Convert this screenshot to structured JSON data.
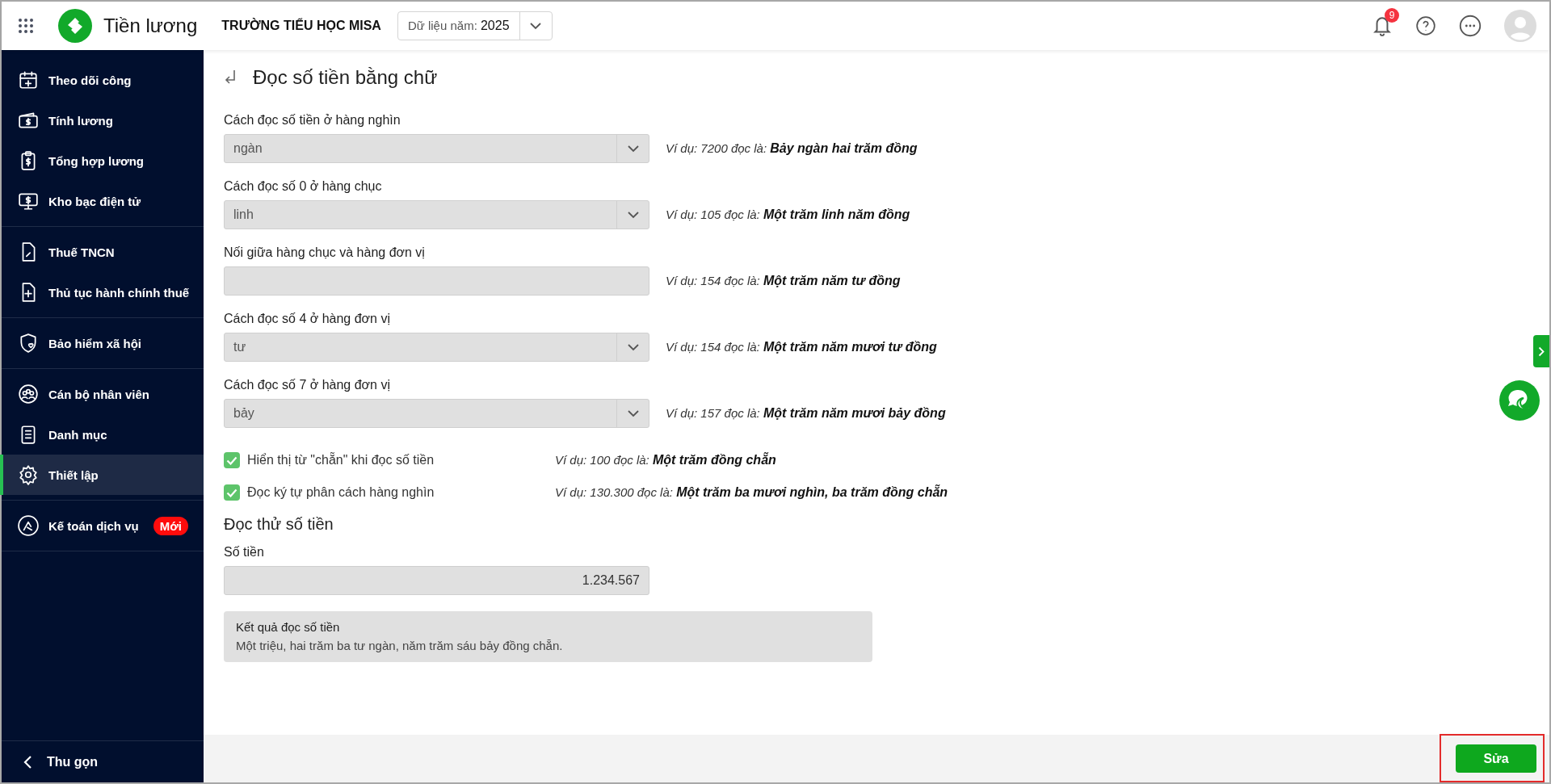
{
  "header": {
    "app_name": "Tiền lương",
    "org_name": "TRƯỜNG TIỂU HỌC MISA",
    "year_selector": {
      "label": "Dữ liệu năm:",
      "value": "2025"
    },
    "notification_count": "9"
  },
  "sidebar": {
    "groups": [
      {
        "items": [
          {
            "label": "Theo dõi công",
            "selected": false
          },
          {
            "label": "Tính lương",
            "selected": false
          },
          {
            "label": "Tổng hợp lương",
            "selected": false
          },
          {
            "label": "Kho bạc điện tử",
            "selected": false
          }
        ]
      },
      {
        "items": [
          {
            "label": "Thuế TNCN",
            "selected": false
          },
          {
            "label": "Thủ tục hành chính thuế",
            "selected": false
          }
        ]
      },
      {
        "items": [
          {
            "label": "Bảo hiểm xã hội",
            "selected": false
          }
        ]
      },
      {
        "items": [
          {
            "label": "Cán bộ nhân viên",
            "selected": false
          },
          {
            "label": "Danh mục",
            "selected": false
          },
          {
            "label": "Thiết lập",
            "selected": true
          }
        ]
      },
      {
        "items": [
          {
            "label": "Kế toán dịch vụ",
            "selected": false,
            "badge": "Mới"
          }
        ]
      }
    ],
    "collapse_label": "Thu gọn"
  },
  "page": {
    "title": "Đọc số tiền bằng chữ",
    "fields": [
      {
        "kind": "select",
        "label": "Cách đọc số tiền ở hàng nghìn",
        "value": "ngàn",
        "example": "Ví dụ: 7200 đọc là: **Bảy ngàn hai trăm đồng**"
      },
      {
        "kind": "select",
        "label": "Cách đọc số 0 ở hàng chục",
        "value": "linh",
        "example": "Ví dụ: 105 đọc là: **Một trăm linh năm đồng**"
      },
      {
        "kind": "text",
        "label": "Nối giữa hàng chục và hàng đơn vị",
        "example": "Ví dụ: 154 đọc là: **Một trăm năm tư đồng**"
      },
      {
        "kind": "select",
        "label": "Cách đọc số 4 ở hàng đơn vị",
        "value": "tư",
        "example": "Ví dụ: 154 đọc là: **Một trăm năm mươi tư đồng**"
      },
      {
        "kind": "select",
        "label": "Cách đọc số 7 ở hàng đơn vị",
        "value": "bảy",
        "example": "Ví dụ: 157 đọc là: **Một trăm năm mươi bảy đồng**"
      }
    ],
    "options": [
      {
        "label": "Hiển thị từ \"chẵn\" khi đọc số tiền",
        "checked": true,
        "example": "Ví dụ: 100 đọc là: **Một trăm đồng chẵn**"
      },
      {
        "label": "Đọc ký tự phân cách hàng nghìn",
        "checked": true,
        "example": "Ví dụ: 130.300 đọc là: **Một trăm ba mươi nghìn, ba trăm đồng chẵn**"
      }
    ],
    "test_section": {
      "title": "Đọc thử số tiền",
      "amount_label": "Số tiền",
      "amount_value": "1.234.567",
      "result_title": "Kết quả đọc số tiền",
      "result_text": "Một triệu, hai trăm ba tư ngàn, năm trăm sáu bảy đồng chẵn."
    }
  },
  "footer": {
    "buttons": [
      "Sửa"
    ]
  }
}
